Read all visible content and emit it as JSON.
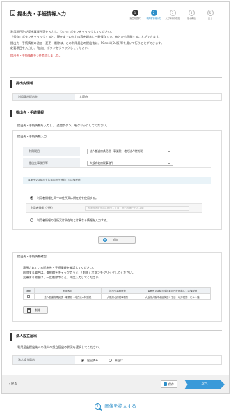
{
  "page": {
    "title": "提出先・手続情報入力"
  },
  "steps": [
    {
      "num": "1",
      "label": "提出先選択",
      "state": "done"
    },
    {
      "num": "2",
      "label": "利用者情報入力",
      "state": "current"
    },
    {
      "num": "3",
      "label": "入力情報の確認",
      "state": "todo"
    },
    {
      "num": "4",
      "label": "電子署名",
      "state": "todo"
    },
    {
      "num": "5",
      "label": "完了",
      "state": "todo"
    }
  ],
  "intro": {
    "line1": "利用税目及び提出事業所等を入力し、「次へ」ボタンをクリックしてください。",
    "line2": "「保存」ボタンをクリックすると、現在までの入力内容を端末に一時保存でき、あとから再開することができます。",
    "line3": "提出先・手続情報の追加・変更・削除は、この利用届出の提出後に、PCdesk(DL版)等を用いて行うことができます。",
    "line4": "必要項目を入力し、「追加」ボタンをクリックしてください。",
    "error": "提出先・手続情報を1件追加しました。"
  },
  "destination_section": {
    "heading": "提出先情報",
    "row_label": "利用届出提出先",
    "row_value": "大阪府"
  },
  "procedure_section": {
    "heading": "提出先・手続情報",
    "instruction": "提出先・手続情報を入力し、「追加ボタン」をクリックしてください。",
    "input_panel_title": "提出先・手続情報入力",
    "tax_label": "利用税目",
    "tax_value": "法人都道府県民税・事業税・地方法人特別税",
    "office_label": "提出先事務所等",
    "office_value": "大阪府北府税事務所",
    "address_bar": "事業所又は給与支払者の所在地若しくは課税地",
    "radio_same": "利用者情報と同一の住所又は所在地を使用する。",
    "address_label": "利用者情報（住所）",
    "address_value": "大阪府大阪市北区梅田１丁目　地方税第一ビル１階",
    "radio_diff": "利用者情報の住所又は所在地とは異なる情報を入力する。",
    "add_button": "追加",
    "confirm_panel_title": "提出先・手続情報確認",
    "confirm_line1": "表示されている提出先・手続情報を確認してください。",
    "confirm_line2": "削除する場合は、選択欄をチェックのうえ、「削除」ボタンをクリックしてください。",
    "confirm_line3": "変更する場合は、一度削除のうえ、再度入力してください。",
    "table_headers": [
      "選択",
      "利用税目",
      "提出先事務所等",
      "事業所又は給与支払者の所在地若しくは課税地"
    ],
    "table_rows": [
      {
        "tax": "法人都道府県民税・事業税・地方法人特別税",
        "office": "大阪府北府税事務所",
        "address": "大阪府大阪市北区梅田１丁目　地方税第一ビル１階"
      }
    ],
    "delete_button": "削除"
  },
  "corporate_section": {
    "heading": "法人設立届出",
    "instruction": "利用届出提出先への法人の設立届出の状況を選択してください。",
    "row_label": "法人設立届出",
    "option_done": "届出済み",
    "option_undone": "未届け"
  },
  "footer": {
    "back": "戻る",
    "save": "保存",
    "next": "次へ"
  },
  "zoom_link": "画像を拡大する"
}
